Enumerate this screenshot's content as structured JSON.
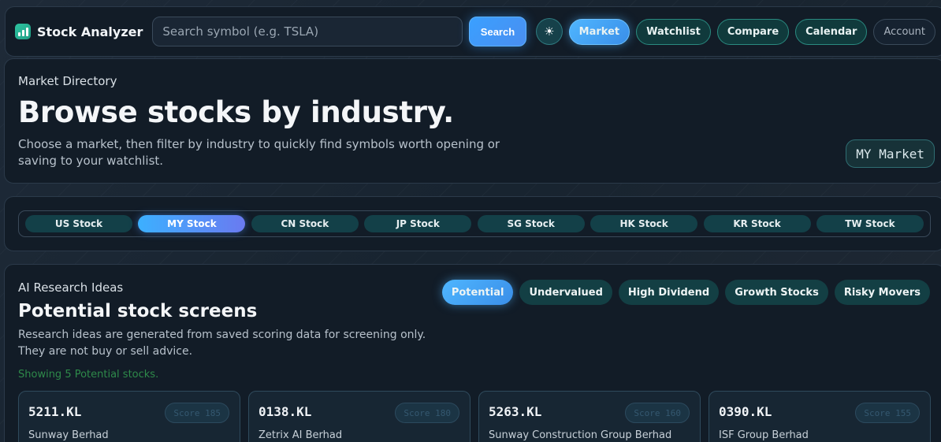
{
  "header": {
    "app_title": "Stock Analyzer",
    "search_placeholder": "Search symbol (e.g. TSLA)",
    "search_button": "Search",
    "theme_icon": "sun-icon",
    "nav": [
      {
        "label": "Market",
        "active": true
      },
      {
        "label": "Watchlist",
        "active": false
      },
      {
        "label": "Compare",
        "active": false
      },
      {
        "label": "Calendar",
        "active": false
      },
      {
        "label": "Account",
        "active": false
      }
    ]
  },
  "directory": {
    "eyebrow": "Market Directory",
    "title": "Browse stocks by industry.",
    "description": "Choose a market, then filter by industry to quickly find symbols worth opening or saving to your watchlist.",
    "market_badge": "MY Market"
  },
  "market_tabs": [
    "US Stock",
    "MY Stock",
    "CN Stock",
    "JP Stock",
    "SG Stock",
    "HK Stock",
    "KR Stock",
    "TW Stock"
  ],
  "active_market_tab": "MY Stock",
  "research": {
    "eyebrow": "AI Research Ideas",
    "title": "Potential stock screens",
    "description": "Research ideas are generated from saved scoring data for screening only. They are not buy or sell advice.",
    "showing": "Showing 5 Potential stocks.",
    "filters": [
      "Potential",
      "Undervalued",
      "High Dividend",
      "Growth Stocks",
      "Risky Movers"
    ],
    "active_filter": "Potential",
    "cards": [
      {
        "symbol": "5211.KL",
        "score": "Score 185",
        "name": "Sunway Berhad"
      },
      {
        "symbol": "0138.KL",
        "score": "Score 180",
        "name": "Zetrix AI Berhad"
      },
      {
        "symbol": "5263.KL",
        "score": "Score 160",
        "name": "Sunway Construction Group Berhad"
      },
      {
        "symbol": "0390.KL",
        "score": "Score 155",
        "name": "ISF Group Berhad"
      }
    ]
  },
  "colors": {
    "accent": "#3aa0ff",
    "teal": "#133f44",
    "panel": "#121c27"
  }
}
